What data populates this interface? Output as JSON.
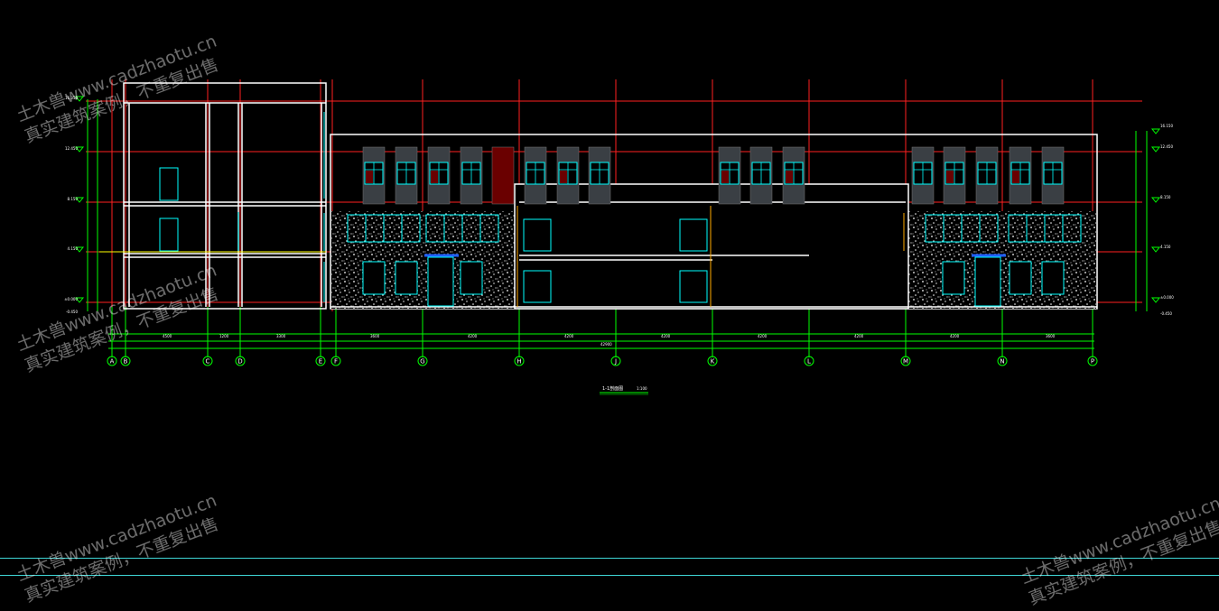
{
  "drawing": {
    "title": "1-1剖面图",
    "scale": "1:100",
    "axis_labels": [
      "A",
      "B",
      "C",
      "D",
      "E",
      "F",
      "G",
      "H",
      "J",
      "K",
      "L",
      "M",
      "N",
      "P"
    ],
    "level_marks_left": [
      "16.350",
      "12.450",
      "8.150",
      "4.150",
      "±0.000",
      "-0.450"
    ],
    "level_marks_right": [
      "16.150",
      "12.450",
      "8.150",
      "4.150",
      "±0.000",
      "-0.450"
    ],
    "colors": {
      "background": "#000000",
      "axis_red": "#ff2020",
      "grid_green": "#00ff00",
      "wall_white": "#ffffff",
      "window_cyan": "#00ffff",
      "mullion_maroon": "#8b0000",
      "highlight_yellow": "#ffff00"
    }
  },
  "watermark": {
    "line1": "土木兽www.cadzhaotu.cn",
    "line2": "真实建筑案例，不重复出售"
  }
}
